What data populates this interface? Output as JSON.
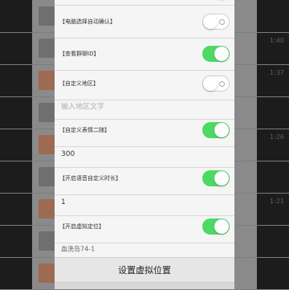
{
  "background": {
    "times": [
      "1:40",
      "1:37",
      "",
      "1:26",
      "",
      "",
      "1:21",
      "",
      ""
    ]
  },
  "settings": {
    "rows": [
      {
        "label": "",
        "on": true
      },
      {
        "label": "【电脑选择自动确认】",
        "on": false
      },
      {
        "label": "【查看群聊ID】",
        "on": true
      },
      {
        "label": "【自定义地区】",
        "on": false
      }
    ],
    "region_placeholder": "输入地区文字",
    "custom_expression": {
      "label": "【自定义表情二随】",
      "on": true
    },
    "expression_value": "300",
    "voice_duration": {
      "label": "【开启语音自定义时长】",
      "on": true
    },
    "voice_value": "1",
    "virtual_location": {
      "label": "【开启虚拟定位】",
      "on": true
    },
    "location_value": "血洗岛74-1",
    "set_location_button": "设置虚拟位置"
  },
  "colors": {
    "toggle_on": "#4cd964",
    "dialog_bg": "#f5f5f5",
    "overlay": "#8a8a8a"
  }
}
